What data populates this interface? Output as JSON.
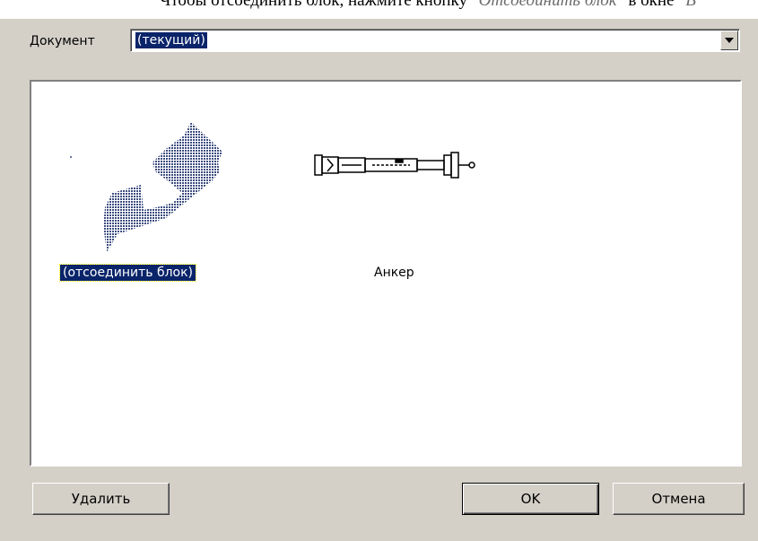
{
  "top_caption": {
    "prefix": "Чтобы отсоединить блок, нажмите кнопку",
    "italic": "\"Отсоединить блок\"",
    "middle": "в окне",
    "italic2": "\"В"
  },
  "document": {
    "label": "Документ",
    "value": "(текущий)"
  },
  "blocks": [
    {
      "label": "(отсоединить блок)",
      "icon": "detach-arrow-icon",
      "selected": true
    },
    {
      "label": "Анкер",
      "icon": "anchor-bolt-icon",
      "selected": false
    }
  ],
  "buttons": {
    "delete": "Удалить",
    "ok": "OK",
    "cancel": "Отмена"
  },
  "colors": {
    "dialog_bg": "#d4d0c8",
    "selection": "#0a246a",
    "arrow_fill": "#4a5a8a"
  }
}
